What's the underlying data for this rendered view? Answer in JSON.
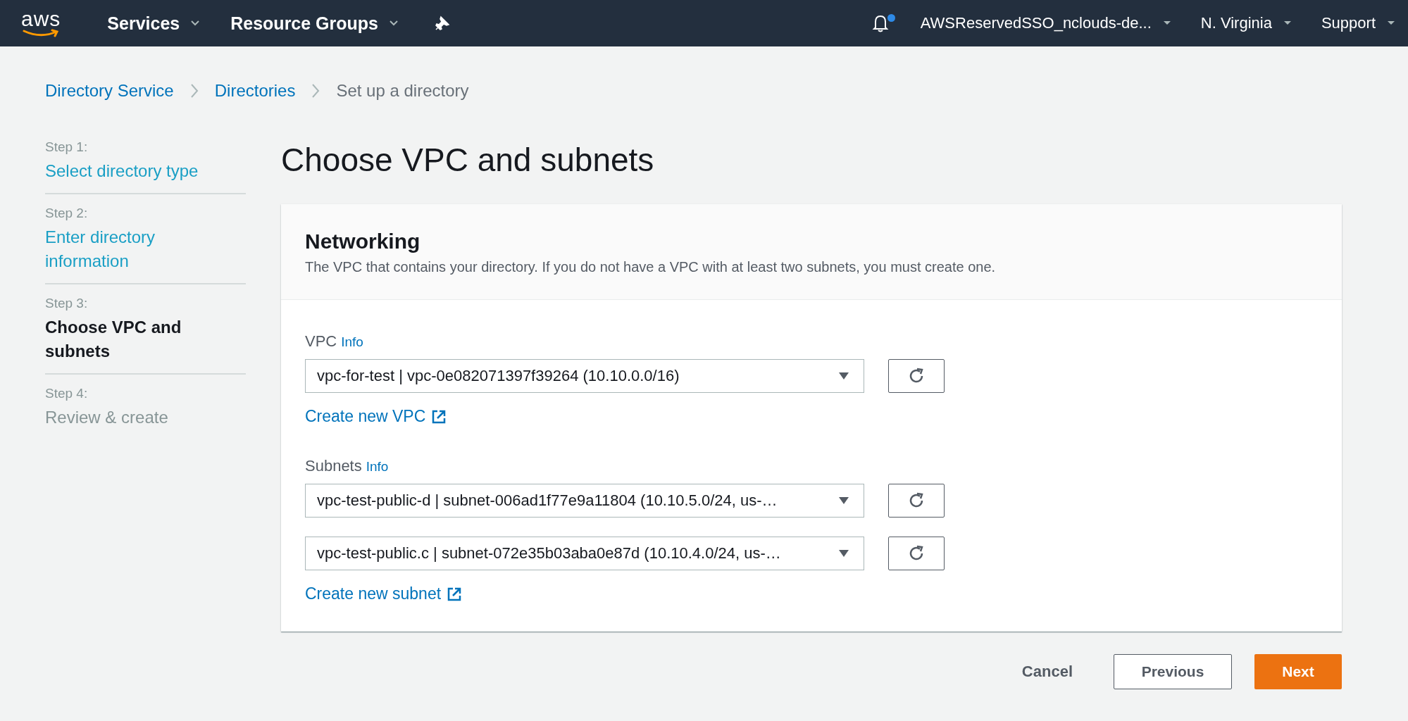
{
  "nav": {
    "logo": "aws",
    "menus": [
      "Services",
      "Resource Groups"
    ],
    "notifications": {
      "unread": true
    },
    "right_menus": [
      "AWSReservedSSO_nclouds-de...",
      "N. Virginia",
      "Support"
    ]
  },
  "breadcrumbs": [
    {
      "label": "Directory Service",
      "link": true
    },
    {
      "label": "Directories",
      "link": true
    },
    {
      "label": "Set up a directory",
      "link": false
    }
  ],
  "steps": [
    {
      "step": "Step 1:",
      "label": "Select directory type",
      "selected": false,
      "completed": true
    },
    {
      "step": "Step 2:",
      "label": "Enter directory information",
      "selected": false,
      "completed": true
    },
    {
      "step": "Step 3:",
      "label": "Choose VPC and subnets",
      "selected": true,
      "completed": false
    },
    {
      "step": "Step 4:",
      "label": "Review & create",
      "selected": false,
      "completed": false
    }
  ],
  "title": "Choose VPC and subnets",
  "panel": {
    "title": "Networking",
    "description": "The VPC that contains your directory. If you do not have a VPC with at least two subnets, you must create one.",
    "vpc": {
      "label": "VPC",
      "info": "Info",
      "selects": [
        "vpc-for-test | vpc-0e082071397f39264 (10.10.0.0/16)"
      ],
      "create_link": "Create new VPC"
    },
    "subnets": {
      "label": "Subnets",
      "info": "Info",
      "selects": [
        "vpc-test-public-d | subnet-006ad1f77e9a11804 (10.10.5.0/24, us-…",
        "vpc-test-public.c | subnet-072e35b03aba0e87d (10.10.4.0/24, us-…"
      ],
      "create_link": "Create new subnet"
    }
  },
  "buttons": {
    "cancel": "Cancel",
    "previous": "Previous",
    "next": "Next"
  }
}
